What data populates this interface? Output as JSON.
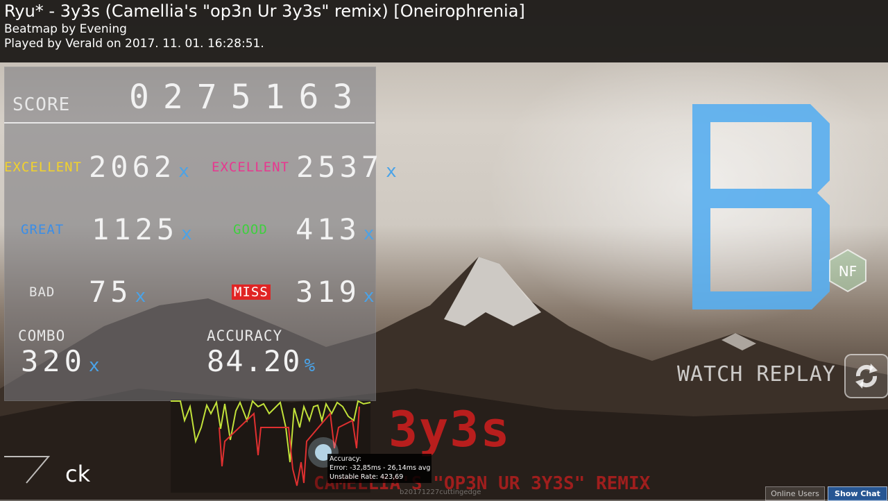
{
  "header": {
    "title": "Ryu* - 3y3s (Camellia's \"op3n Ur 3y3s\" remix) [Oneirophrenia]",
    "beatmap_by": "Beatmap by Evening",
    "played_by": "Played by Verald on 2017. 11. 01. 16:28:51."
  },
  "score": {
    "label": "SCORE",
    "value": "0275163"
  },
  "judgements": {
    "excellent_a": {
      "label": "EXCELLENT",
      "count": "2062",
      "color": "#f2d22c"
    },
    "excellent_b": {
      "label": "EXCELLENT",
      "count": "2537",
      "color": "#e8378f"
    },
    "great": {
      "label": "GREAT",
      "count": "1125",
      "color": "#3a8ee8"
    },
    "good": {
      "label": "GOOD",
      "count": "413",
      "color": "#3fcf3f"
    },
    "bad": {
      "label": "BAD",
      "count": "75",
      "color": "#e6e6e6"
    },
    "miss": {
      "label": "MISS",
      "count": "319",
      "color": "#e02424"
    },
    "x_suffix": "x"
  },
  "combo": {
    "label": "COMBO",
    "value": "320"
  },
  "accuracy": {
    "label": "ACCURACY",
    "value": "84.20",
    "suffix": "%"
  },
  "grade": {
    "letter": "B",
    "mod": "NF",
    "color": "#58aef0"
  },
  "watch_replay": "WATCH REPLAY",
  "back_label": "ck",
  "tooltip": {
    "line1": "Accuracy:",
    "line2": "Error: -32,85ms - 26,14ms avg",
    "line3": "Unstable Rate: 423,69"
  },
  "bg_title": {
    "main": "3y3s",
    "sub": "CAMELLIA'S \"OP3N UR 3Y3S\" REMIX"
  },
  "footer_note": "b20171227cuttingedge",
  "buttons": {
    "online_users": "Online Users",
    "show_chat": "Show Chat"
  }
}
